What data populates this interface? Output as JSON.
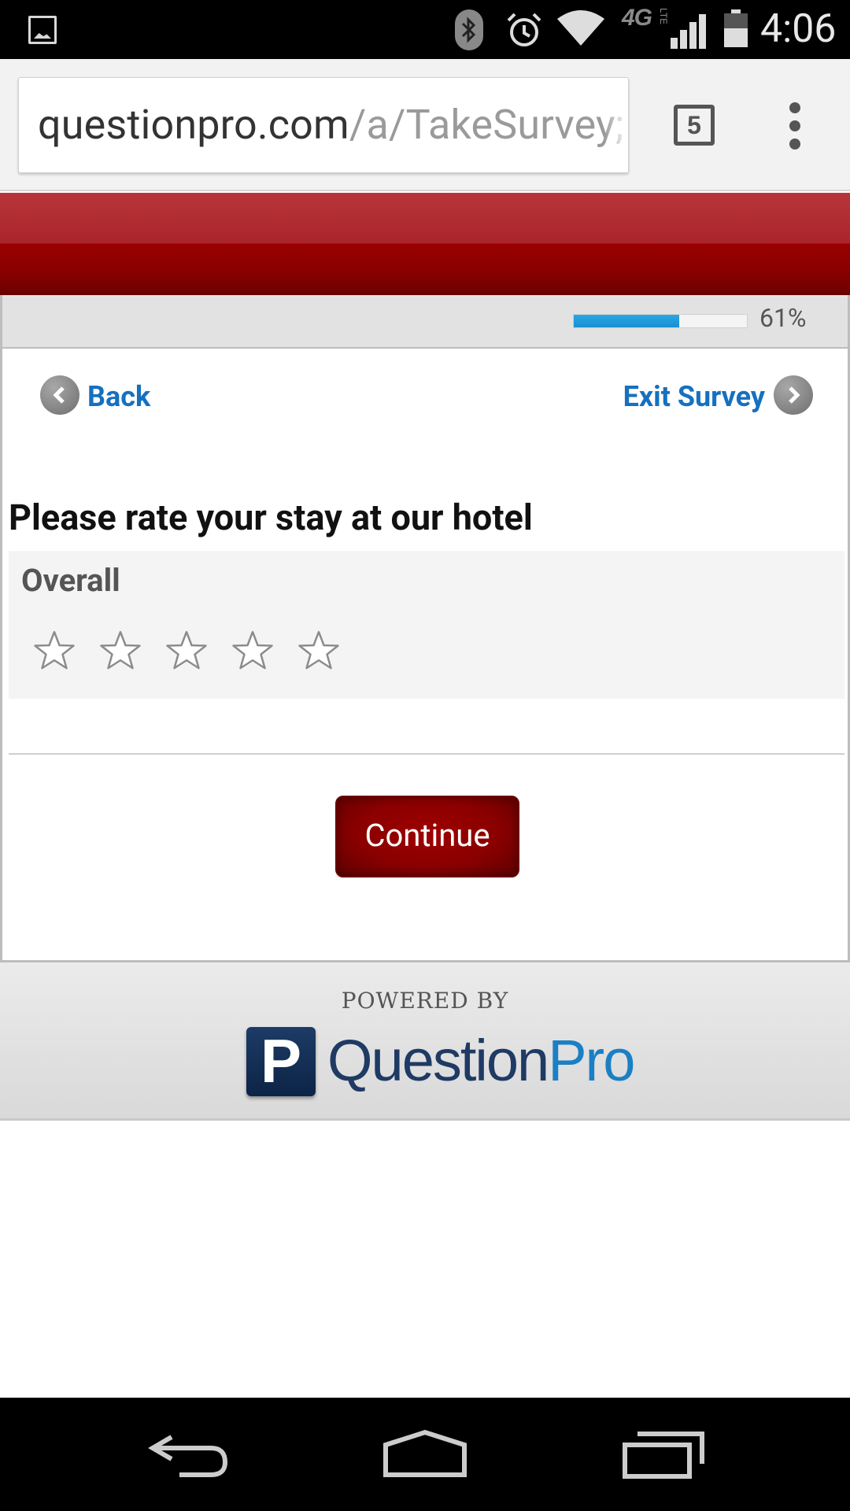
{
  "status_bar": {
    "time": "4:06",
    "network": "4G",
    "network_sub": "LTE",
    "icons": [
      "gallery-notification-icon",
      "bluetooth-icon",
      "alarm-icon",
      "wifi-icon",
      "signal-icon",
      "battery-icon"
    ]
  },
  "browser": {
    "url_host": "questionpro.com",
    "url_path": "/a/TakeSurvey;",
    "tab_count": "5"
  },
  "progress": {
    "percent_label": "61%",
    "value": 0.61,
    "fill_color": "#1a8fd4"
  },
  "survey": {
    "back_label": "Back",
    "exit_label": "Exit Survey",
    "question_title": "Please rate your stay at our hotel",
    "rating_label": "Overall",
    "star_count": 5,
    "selected_stars": 0,
    "continue_label": "Continue"
  },
  "footer": {
    "powered_by": "POWERED BY",
    "logo_mark": "P",
    "logo_word_main": "Question",
    "logo_word_accent": "Pro"
  },
  "colors": {
    "header_red": "#9a0000",
    "link_blue": "#1670c0",
    "button_red": "#8a0000"
  }
}
